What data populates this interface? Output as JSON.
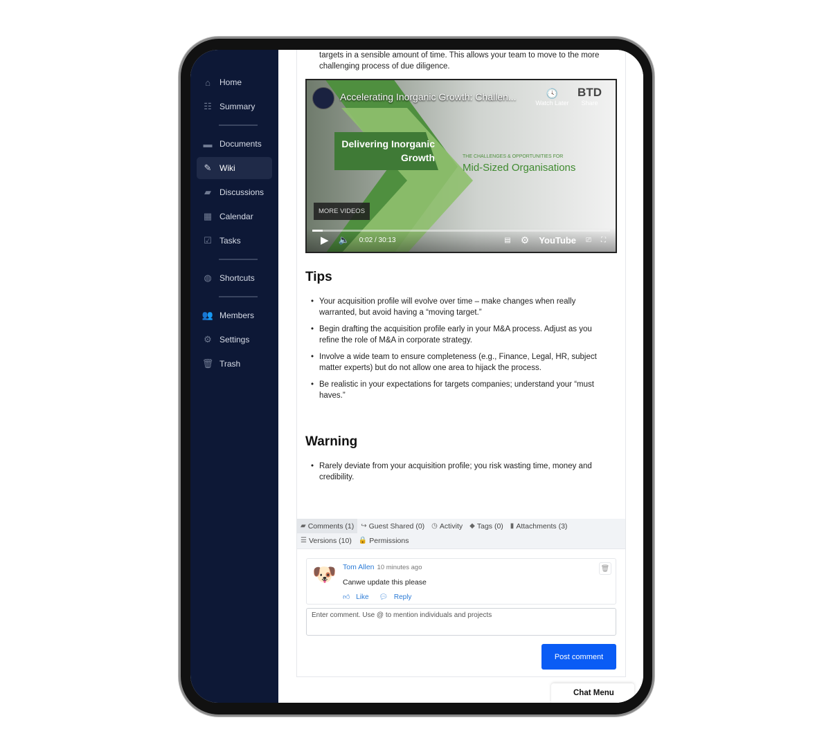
{
  "sidebar": {
    "items": [
      {
        "label": "Home",
        "icon": "home-icon"
      },
      {
        "label": "Summary",
        "icon": "summary-icon"
      },
      {
        "label": "Documents",
        "icon": "folder-icon"
      },
      {
        "label": "Wiki",
        "icon": "edit-icon",
        "active": true
      },
      {
        "label": "Discussions",
        "icon": "chat-icon"
      },
      {
        "label": "Calendar",
        "icon": "calendar-icon"
      },
      {
        "label": "Tasks",
        "icon": "checkbox-icon"
      },
      {
        "label": "Shortcuts",
        "icon": "globe-icon"
      },
      {
        "label": "Members",
        "icon": "users-icon"
      },
      {
        "label": "Settings",
        "icon": "gear-icon"
      },
      {
        "label": "Trash",
        "icon": "trash-icon"
      }
    ]
  },
  "content": {
    "intro": "targets in a sensible amount of time. This allows your team to move to the more challenging process of due diligence.",
    "video": {
      "title": "Accelerating Inorganic Growth: Challen...",
      "watch_later": "Watch Later",
      "share": "Share",
      "brand": "BTD",
      "slide_title": "Delivering Inorganic Growth",
      "slide_sub": "THE CHALLENGES & OPPORTUNITIES FOR",
      "slide_main": "Mid-Sized Organisations",
      "more_videos": "MORE VIDEOS",
      "time": "0:02 / 30:13",
      "youtube": "YouTube",
      "progress": 0.035
    },
    "tips_heading": "Tips",
    "tips": [
      "Your acquisition profile will evolve over time – make changes when really warranted, but avoid having a “moving target.”",
      "Begin drafting the acquisition profile early in your M&A process. Adjust as you refine the role of M&A in corporate strategy.",
      "Involve a wide team to ensure completeness (e.g., Finance, Legal, HR, subject matter experts) but do not allow one area to hijack the process.",
      "Be realistic in your expectations for targets companies; understand your “must haves.”"
    ],
    "warning_heading": "Warning",
    "warnings": [
      "Rarely deviate from your acquisition profile; you risk wasting time, money and credibility."
    ]
  },
  "tabs": [
    {
      "label": "Comments (1)",
      "icon": "comment-icon"
    },
    {
      "label": "Guest Shared (0)",
      "icon": "share-icon"
    },
    {
      "label": "Activity",
      "icon": "clock-icon"
    },
    {
      "label": "Tags (0)",
      "icon": "tag-icon"
    },
    {
      "label": "Attachments (3)",
      "icon": "file-icon"
    },
    {
      "label": "Versions (10)",
      "icon": "list-icon"
    },
    {
      "label": "Permissions",
      "icon": "lock-icon"
    }
  ],
  "comment": {
    "author": "Tom Allen",
    "time": "10 minutes ago",
    "text": "Canwe update this please",
    "like": "Like",
    "reply": "Reply"
  },
  "comment_input": {
    "placeholder": "Enter comment. Use @ to mention individuals and projects"
  },
  "post_label": "Post comment",
  "chat_menu": "Chat Menu"
}
